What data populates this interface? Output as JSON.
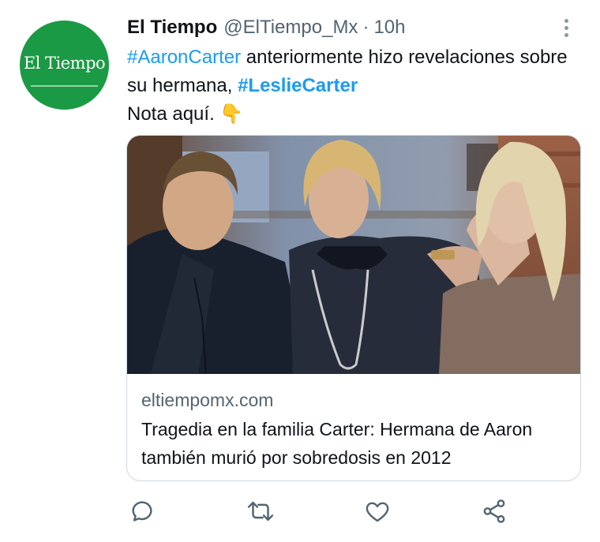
{
  "tweet": {
    "avatar_label": "El Tiempo",
    "author_name": "El Tiempo",
    "handle": "@ElTiempo_Mx",
    "separator": "·",
    "time": "10h",
    "text": {
      "hashtag1": "#AaronCarter",
      "part1": " anteriormente hizo revelaciones sobre su hermana, ",
      "hashtag2": "#LeslieCarter",
      "line2": "Nota aquí. ",
      "emoji": "👇"
    }
  },
  "link_card": {
    "domain": "eltiempomx.com",
    "title": "Tragedia en la familia Carter: Hermana de Aaron también murió por sobredosis en 2012"
  },
  "actions": {
    "reply_icon": "reply-icon",
    "retweet_icon": "retweet-icon",
    "like_icon": "heart-icon",
    "share_icon": "share-icon"
  },
  "colors": {
    "link": "#1d9bf0",
    "avatar_bg": "#1a9a44",
    "secondary_text": "#536471",
    "icon": "#536471"
  }
}
